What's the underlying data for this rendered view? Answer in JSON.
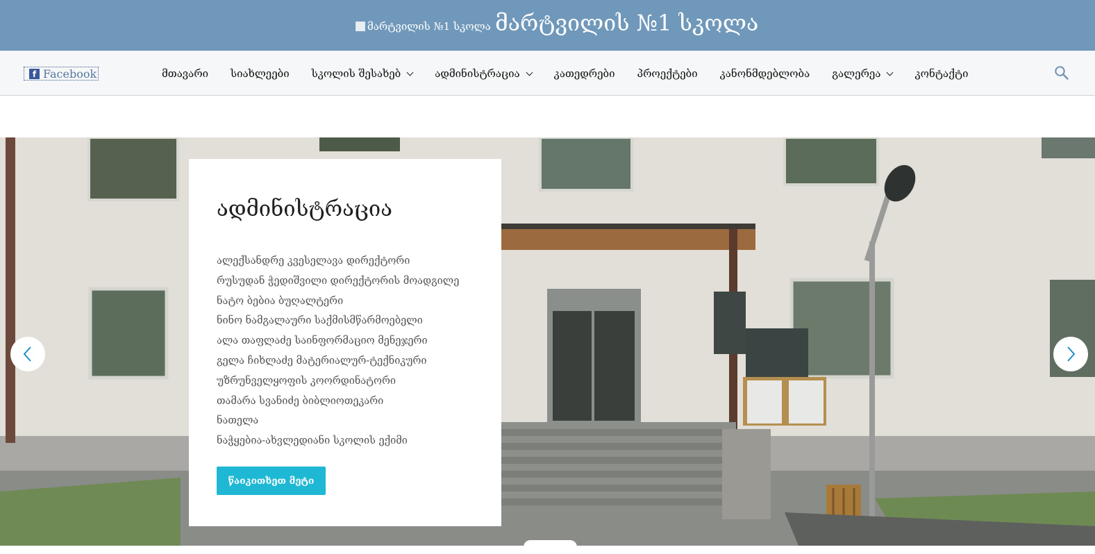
{
  "header": {
    "logo_alt": "მარტვილის №1 სკოლა",
    "site_title": "მარტვილის №1 სკოლა",
    "bg_color": "#7098ba"
  },
  "social": {
    "facebook_label": "Facebook"
  },
  "nav": {
    "items": [
      {
        "label": "მთავარი",
        "dropdown": false
      },
      {
        "label": "სიახლეები",
        "dropdown": false
      },
      {
        "label": "სკოლის შესახებ",
        "dropdown": true
      },
      {
        "label": "ადმინისტრაცია",
        "dropdown": true
      },
      {
        "label": "კათედრები",
        "dropdown": false
      },
      {
        "label": "პროექტები",
        "dropdown": false
      },
      {
        "label": "კანონმდებლობა",
        "dropdown": false
      },
      {
        "label": "გალერეა",
        "dropdown": true
      },
      {
        "label": "კონტაქტი",
        "dropdown": false
      }
    ],
    "search_icon": "search-icon"
  },
  "slide": {
    "title": "ადმინისტრაცია",
    "lines": [
      "ალექსანდრე კვესელავა დირექტორი",
      "რუსუდან ჭედიშვილი დირექტორის მოადგილე",
      "ნატო ბებია ბუღალტერი",
      "ნინო ნამგალაური საქმისმწარმოებელი",
      "ალა თაფლაძე საინფორმაციო მენეჯერი",
      "გელა ჩიხლაძე მატერიალურ-ტექნიკური",
      "უზრუნველყოფის კოორდინატორი",
      "თამარა სვანიძე ბიბლიოთეკარი",
      "ნათელა",
      "ნაჭყებია-ახვლედიანი სკოლის ექიმი"
    ],
    "button_label": "წაიკითხეთ მეტი",
    "button_color": "#1fb8d4"
  }
}
